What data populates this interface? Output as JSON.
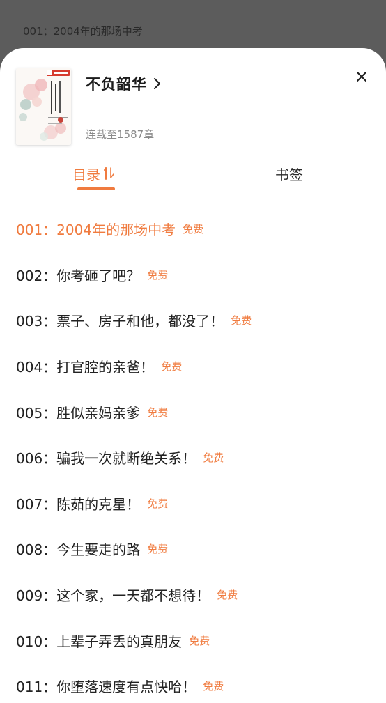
{
  "background": {
    "current_chapter": "001：2004年的那场中考"
  },
  "book": {
    "title": "不负韶华",
    "status": "连载至1587章",
    "cover": {
      "publisher_logo_text": "潇湘中文网",
      "cover_title": "不负韶华",
      "author_text": "文盲鸟"
    }
  },
  "tabs": [
    {
      "label": "目录",
      "active": true
    },
    {
      "label": "书签",
      "active": false
    }
  ],
  "chapters": [
    {
      "title": "001：2004年的那场中考",
      "badge": "免费",
      "current": true
    },
    {
      "title": "002：你考砸了吧？",
      "badge": "免费"
    },
    {
      "title": "003：票子、房子和他，都没了！",
      "badge": "免费"
    },
    {
      "title": "004：打官腔的亲爸！",
      "badge": "免费"
    },
    {
      "title": "005：胜似亲妈亲爹",
      "badge": "免费"
    },
    {
      "title": "006：骗我一次就断绝关系！",
      "badge": "免费"
    },
    {
      "title": "007：陈茹的克星！",
      "badge": "免费"
    },
    {
      "title": "008：今生要走的路",
      "badge": "免费"
    },
    {
      "title": "009：这个家，一天都不想待！",
      "badge": "免费"
    },
    {
      "title": "010：上辈子弄丢的真朋友",
      "badge": "免费"
    },
    {
      "title": "011：你堕落速度有点快哈！",
      "badge": "免费"
    }
  ],
  "colors": {
    "accent": "#f07b3f",
    "overlay": "#5c5c5c",
    "text_primary": "#222222",
    "text_secondary": "#8a8a8a"
  },
  "icons": {
    "title_chevron": "chevron-right-icon",
    "close": "close-icon",
    "sort": "sort-order-icon"
  }
}
